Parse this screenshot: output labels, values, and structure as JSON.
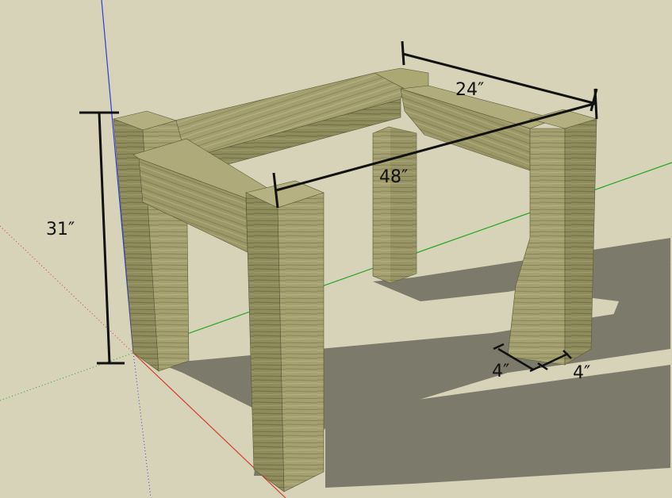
{
  "scene": {
    "background_color": "#d6d3b8",
    "wood_light": "#a9a576",
    "wood_mid": "#8f8c5f",
    "wood_dark": "#6e6c47",
    "shadow_color": "#7c7a6a",
    "axis_blue": "#2f3dd6",
    "axis_red": "#d23b2b",
    "axis_green": "#27a327"
  },
  "dimensions": {
    "height": "31″",
    "length": "48″",
    "depth": "24″",
    "leg_width": "4″",
    "leg_depth": "4″"
  }
}
